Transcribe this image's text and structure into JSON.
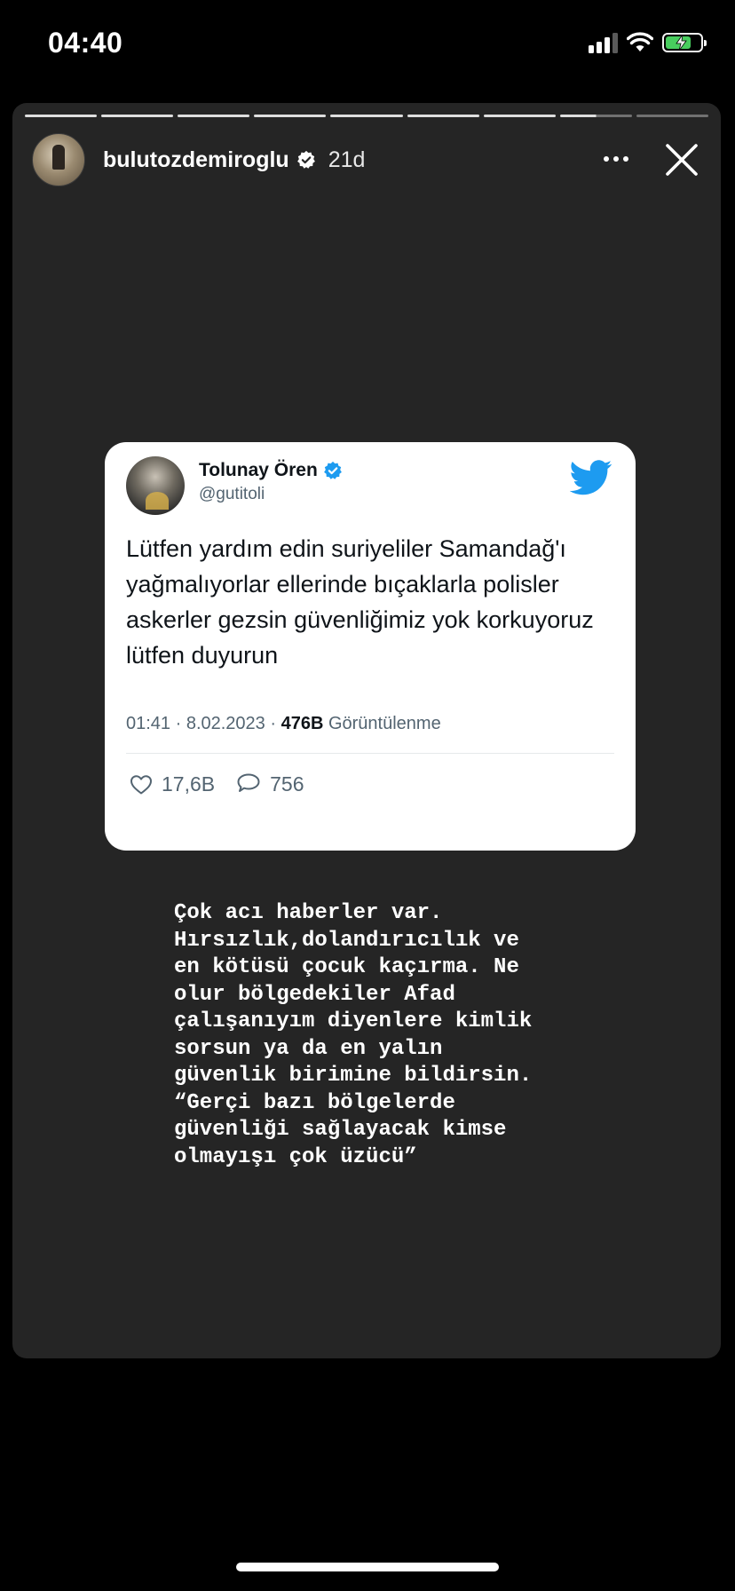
{
  "status_bar": {
    "time": "04:40"
  },
  "story": {
    "progress_segments": 9,
    "header": {
      "username": "bulutozdemiroglu",
      "time_ago": "21d"
    },
    "tweet": {
      "name": "Tolunay Ören",
      "handle": "@gutitoli",
      "text": "Lütfen yardım edin suriyeliler Samandağ'ı yağmalıyorlar ellerinde bıçaklarla polisler askerler gezsin güvenliğimiz yok korkuyoruz lütfen duyurun",
      "timestamp": "01:41 · 8.02.2023 · ",
      "views_count": "476B",
      "views_label": " Görüntülenme",
      "likes": "17,6B",
      "replies": "756"
    },
    "caption": "Çok acı haberler var.\nHırsızlık,dolandırıcılık ve\nen kötüsü çocuk kaçırma. Ne\nolur bölgedekiler Afad\nçalışanıyım diyenlere kimlik\nsorsun ya da en yalın\ngüvenlik birimine bildirsin.\n“Gerçi bazı bölgelerde\ngüvenliği sağlayacak kimse\nolmayışı çok üzücü”"
  },
  "icons": {
    "verified": "verified-badge-icon",
    "twitter": "twitter-bird-icon",
    "like": "heart-icon",
    "reply": "comment-icon",
    "more": "more-dots-icon",
    "close": "close-icon"
  },
  "colors": {
    "twitter_blue": "#1d9bf0",
    "battery_green": "#4cd964",
    "story_bg": "#252525"
  }
}
